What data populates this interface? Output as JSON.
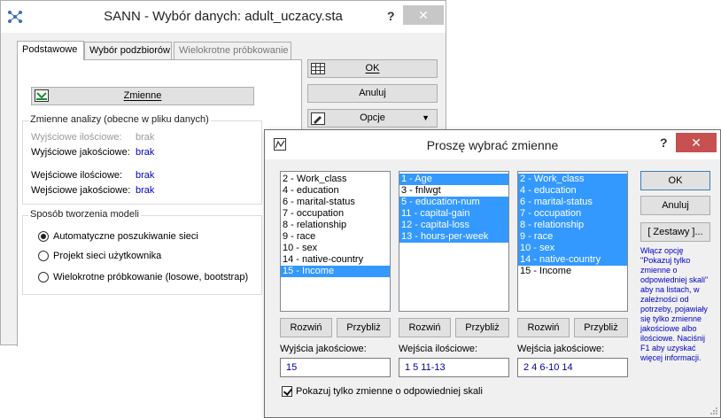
{
  "back_dialog": {
    "title": "SANN - Wybór danych: adult_uczacy.sta",
    "help": "?",
    "close": "✕",
    "tabs": [
      "Podstawowe",
      "Wybór podzbiorów",
      "Wielokrotne próbkowanie"
    ],
    "variables_button": "Zmienne",
    "analysis_group": {
      "title": "Zmienne analizy (obecne w pliku danych)",
      "rows": [
        {
          "label": "Wyjściowe ilościowe:",
          "value": "brak"
        },
        {
          "label": "Wyjściowe jakościowe:",
          "value": "brak"
        },
        {
          "label": "Wejściowe ilościowe:",
          "value": "brak"
        },
        {
          "label": "Wejściowe jakościowe:",
          "value": "brak"
        }
      ]
    },
    "model_group": {
      "title": "Sposób tworzenia modeli",
      "options": [
        {
          "label": "Automatyczne poszukiwanie sieci",
          "selected": true
        },
        {
          "label": "Projekt sieci użytkownika",
          "selected": false
        },
        {
          "label": "Wielokrotne próbkowanie (losowe, bootstrap)",
          "selected": false
        }
      ]
    },
    "ok_button": "OK",
    "cancel_button": "Anuluj",
    "options_button": "Opcje"
  },
  "front_dialog": {
    "title": "Proszę wybrać zmienne",
    "help": "?",
    "close": "✕",
    "lists": [
      {
        "items": [
          {
            "text": "2 - Work_class",
            "selected": false
          },
          {
            "text": "4 - education",
            "selected": false
          },
          {
            "text": "6 - marital-status",
            "selected": false
          },
          {
            "text": "7 - occupation",
            "selected": false
          },
          {
            "text": "8 - relationship",
            "selected": false
          },
          {
            "text": "9 - race",
            "selected": false
          },
          {
            "text": "10 - sex",
            "selected": false
          },
          {
            "text": "14 - native-country",
            "selected": false
          },
          {
            "text": "15 - Income",
            "selected": true
          }
        ]
      },
      {
        "items": [
          {
            "text": "1 - Age",
            "selected": true
          },
          {
            "text": "3 - fnlwgt",
            "selected": false
          },
          {
            "text": "5 - education-num",
            "selected": true
          },
          {
            "text": "11 - capital-gain",
            "selected": true
          },
          {
            "text": "12 - capital-loss",
            "selected": true
          },
          {
            "text": "13 - hours-per-week",
            "selected": true
          }
        ]
      },
      {
        "items": [
          {
            "text": "2 - Work_class",
            "selected": true
          },
          {
            "text": "4 - education",
            "selected": true
          },
          {
            "text": "6 - marital-status",
            "selected": true
          },
          {
            "text": "7 - occupation",
            "selected": true
          },
          {
            "text": "8 - relationship",
            "selected": true
          },
          {
            "text": "9 - race",
            "selected": true
          },
          {
            "text": "10 - sex",
            "selected": true
          },
          {
            "text": "14 - native-country",
            "selected": true
          },
          {
            "text": "15 - Income",
            "selected": false
          }
        ]
      }
    ],
    "expand_label": "Rozwiń",
    "zoom_label": "Przybliż",
    "fields": [
      {
        "label": "Wyjścia jakościowe:",
        "value": "15"
      },
      {
        "label": "Wejścia ilościowe:",
        "value": "1 5 11-13"
      },
      {
        "label": "Wejścia jakościowe:",
        "value": "2 4 6-10 14"
      }
    ],
    "ok_button": "OK",
    "cancel_button": "Anuluj",
    "sets_button": "[ Zestawy ]...",
    "help_text": "Włącz opcję \"Pokazuj tylko zmienne o odpowiedniej skali\" aby na listach, w zależności od potrzeby, pojawiały się tylko zmienne jakościowe albo ilościowe. Naciśnij F1 aby uzyskać więcej informacji.",
    "checkbox_label": "Pokazuj tylko zmienne o odpowiedniej skali",
    "checkbox_checked": true
  }
}
